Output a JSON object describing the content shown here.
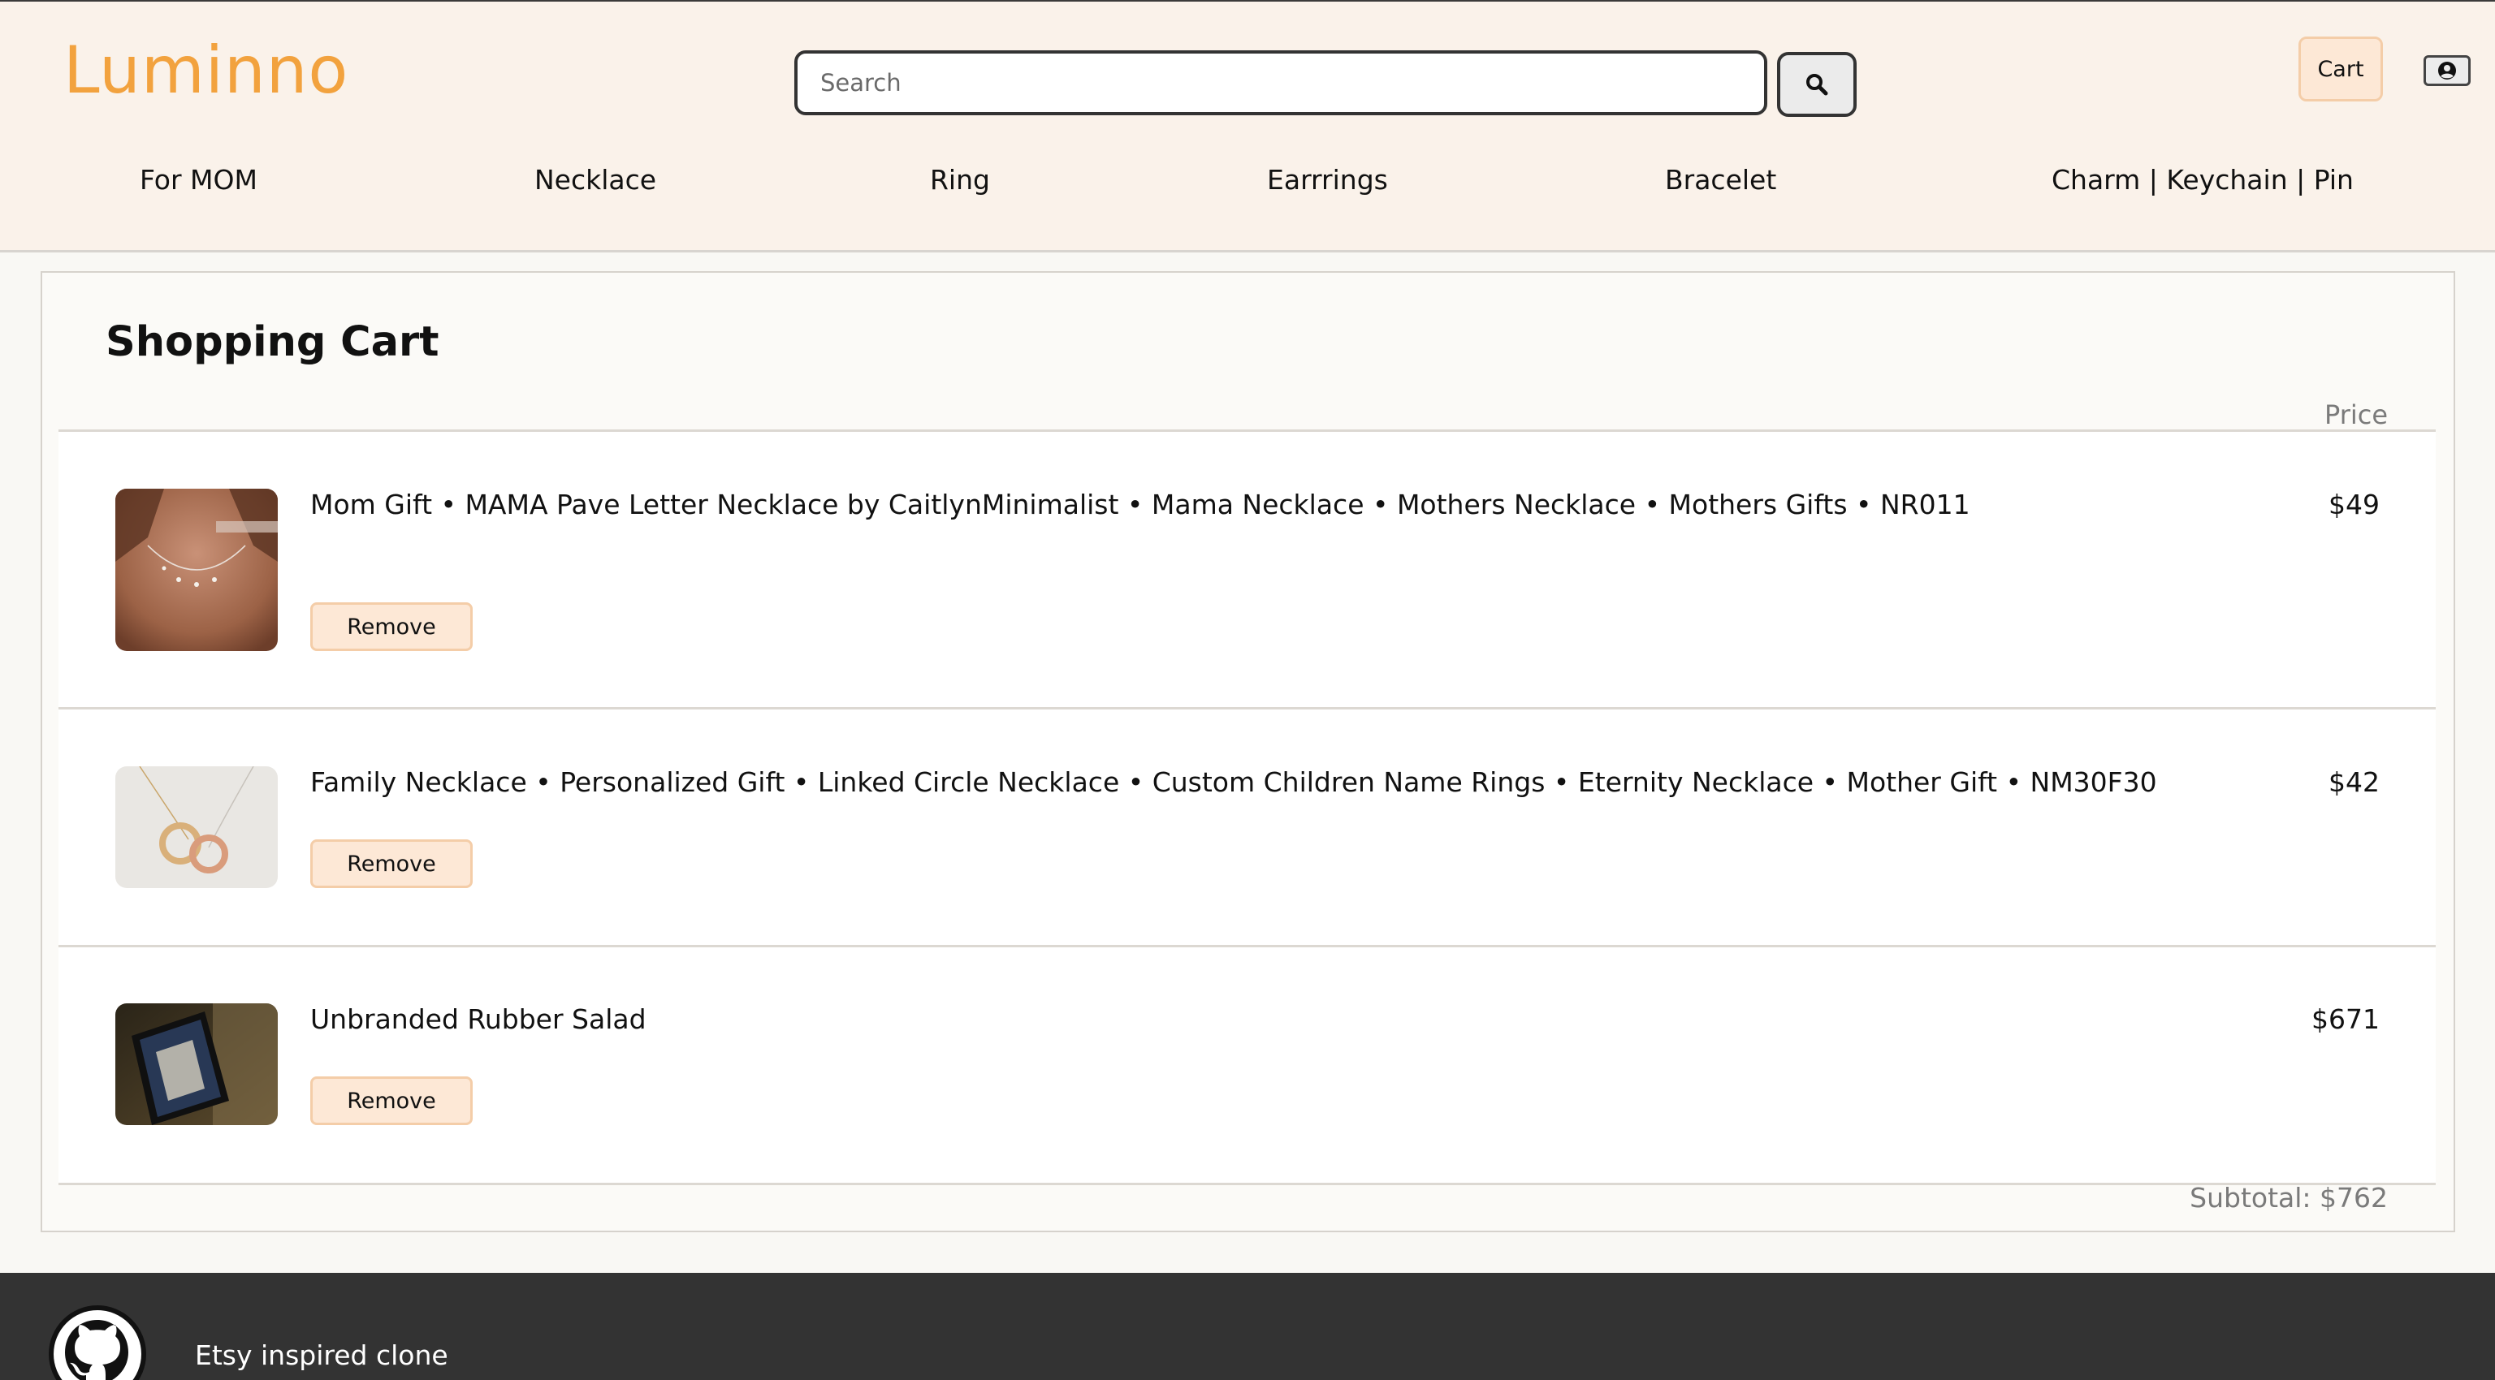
{
  "header": {
    "logo": "Luminno",
    "search_placeholder": "Search",
    "search_icon": "search-icon",
    "cart_label": "Cart",
    "user_icon": "user-circle-icon",
    "nav": [
      "For MOM",
      "Necklace",
      "Ring",
      "Earrrings",
      "Bracelet",
      "Charm | Keychain | Pin"
    ]
  },
  "cart": {
    "title": "Shopping Cart",
    "price_header": "Price",
    "items": [
      {
        "title": "Mom Gift • MAMA Pave Letter Necklace by CaitlynMinimalist • Mama Necklace • Mothers Necklace • Mothers Gifts • NR011",
        "price": "$49",
        "remove_label": "Remove"
      },
      {
        "title": "Family Necklace • Personalized Gift • Linked Circle Necklace • Custom Children Name Rings • Eternity Necklace • Mother Gift • NM30F30",
        "price": "$42",
        "remove_label": "Remove"
      },
      {
        "title": "Unbranded Rubber Salad",
        "price": "$671",
        "remove_label": "Remove"
      }
    ],
    "subtotal": "Subtotal: $762"
  },
  "footer": {
    "icon": "github-icon",
    "text": "Etsy inspired clone"
  },
  "colors": {
    "brand": "#f2a23e",
    "header_bg": "#faf2ea",
    "button_bg": "#fde8d6",
    "footer_bg": "#333333"
  }
}
